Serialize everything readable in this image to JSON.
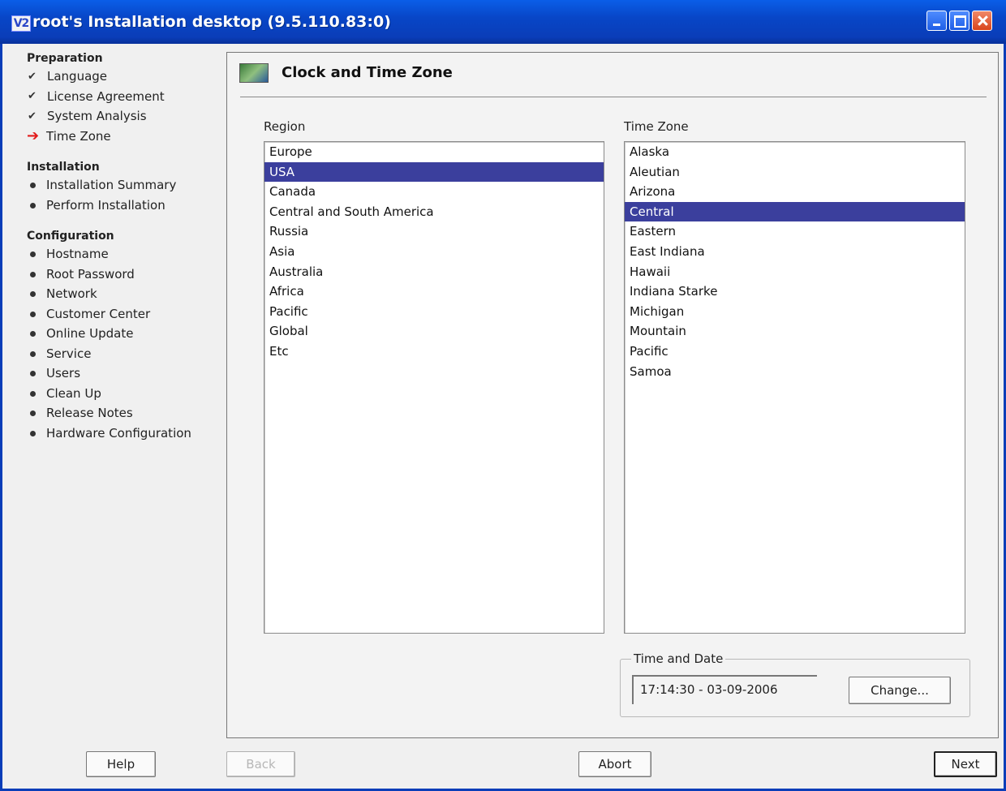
{
  "window": {
    "icon_text": "V2",
    "title": "root's Installation desktop (9.5.110.83:0)"
  },
  "sidebar": {
    "sections": [
      {
        "title": "Preparation",
        "items": [
          {
            "label": "Language",
            "state": "done"
          },
          {
            "label": "License Agreement",
            "state": "done"
          },
          {
            "label": "System Analysis",
            "state": "done"
          },
          {
            "label": "Time Zone",
            "state": "current"
          }
        ]
      },
      {
        "title": "Installation",
        "items": [
          {
            "label": "Installation Summary",
            "state": "pending"
          },
          {
            "label": "Perform Installation",
            "state": "pending"
          }
        ]
      },
      {
        "title": "Configuration",
        "items": [
          {
            "label": "Hostname",
            "state": "pending"
          },
          {
            "label": "Root Password",
            "state": "pending"
          },
          {
            "label": "Network",
            "state": "pending"
          },
          {
            "label": "Customer Center",
            "state": "pending"
          },
          {
            "label": "Online Update",
            "state": "pending"
          },
          {
            "label": "Service",
            "state": "pending"
          },
          {
            "label": "Users",
            "state": "pending"
          },
          {
            "label": "Clean Up",
            "state": "pending"
          },
          {
            "label": "Release Notes",
            "state": "pending"
          },
          {
            "label": "Hardware Configuration",
            "state": "pending"
          }
        ]
      }
    ]
  },
  "main": {
    "title": "Clock and Time Zone",
    "region": {
      "label": "Region",
      "selected": "USA",
      "items": [
        "Europe",
        "USA",
        "Canada",
        "Central and South America",
        "Russia",
        "Asia",
        "Australia",
        "Africa",
        "Pacific",
        "Global",
        "Etc"
      ]
    },
    "timezone": {
      "label": "Time Zone",
      "selected": "Central",
      "items": [
        "Alaska",
        "Aleutian",
        "Arizona",
        "Central",
        "Eastern",
        "East Indiana",
        "Hawaii",
        "Indiana Starke",
        "Michigan",
        "Mountain",
        "Pacific",
        "Samoa"
      ]
    },
    "time_and_date": {
      "legend": "Time and Date",
      "value": "17:14:30 - 03-09-2006",
      "change_label": "Change..."
    }
  },
  "buttons": {
    "help": "Help",
    "back": "Back",
    "abort": "Abort",
    "next": "Next"
  }
}
